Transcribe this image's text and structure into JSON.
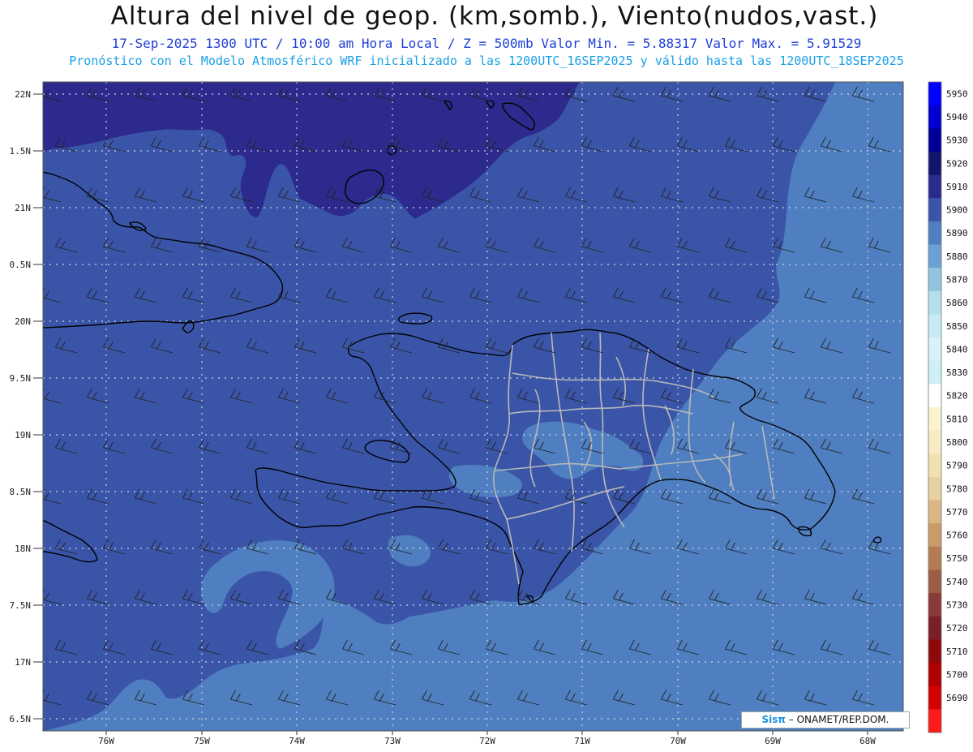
{
  "header": {
    "title": "Altura del nivel de geop. (km,somb.), Viento(nudos,vast.)",
    "info_line": "17-Sep-2025  1300 UTC / 10:00 am Hora Local / Z = 500mb   Valor Min. = 5.88317  Valor Max. = 5.91529",
    "model_line": "Pronóstico con el Modelo Atmosférico WRF inicializado a las 1200UTC_16SEP2025 y válido hasta las  1200UTC_18SEP2025"
  },
  "map": {
    "lat_labels": [
      "22N",
      "1.5N",
      "21N",
      "0.5N",
      "20N",
      "9.5N",
      "19N",
      "8.5N",
      "18N",
      "7.5N",
      "17N",
      "6.5N"
    ],
    "lon_labels": [
      "76W",
      "75W",
      "74W",
      "73W",
      "72W",
      "71W",
      "70W",
      "69W",
      "68W"
    ],
    "colors": {
      "band_5910": "#2c2a8c",
      "band_5900": "#3a55a8",
      "band_5890": "#4f7fc0",
      "land_outline": "#000000",
      "province_outline": "#b9b9b9"
    }
  },
  "colorbar": {
    "labels": [
      "5950",
      "5940",
      "5930",
      "5920",
      "5910",
      "5900",
      "5890",
      "5880",
      "5870",
      "5860",
      "5850",
      "5840",
      "5830",
      "5820",
      "5810",
      "5800",
      "5790",
      "5780",
      "5770",
      "5760",
      "5750",
      "5740",
      "5730",
      "5720",
      "5710",
      "5700",
      "5690"
    ],
    "colors": [
      "#0000ff",
      "#0000d0",
      "#000098",
      "#14146e",
      "#2c2a8c",
      "#3a55a8",
      "#4f7fc0",
      "#6aa0d4",
      "#92c4e2",
      "#b4e0ee",
      "#c8ebf3",
      "#d9f2f8",
      "#cdf0f6",
      "#ffffff",
      "#fbf3cf",
      "#f6ebc4",
      "#f1e0b2",
      "#e8d1a0",
      "#dab684",
      "#c99b69",
      "#b47c54",
      "#9d5c44",
      "#8a3a38",
      "#7a1f28",
      "#8c0a0a",
      "#b00000",
      "#d40000",
      "#ff1a1a"
    ]
  },
  "credit": {
    "logo": "Sisπ",
    "org": "– ONAMET/REP.DOM."
  }
}
